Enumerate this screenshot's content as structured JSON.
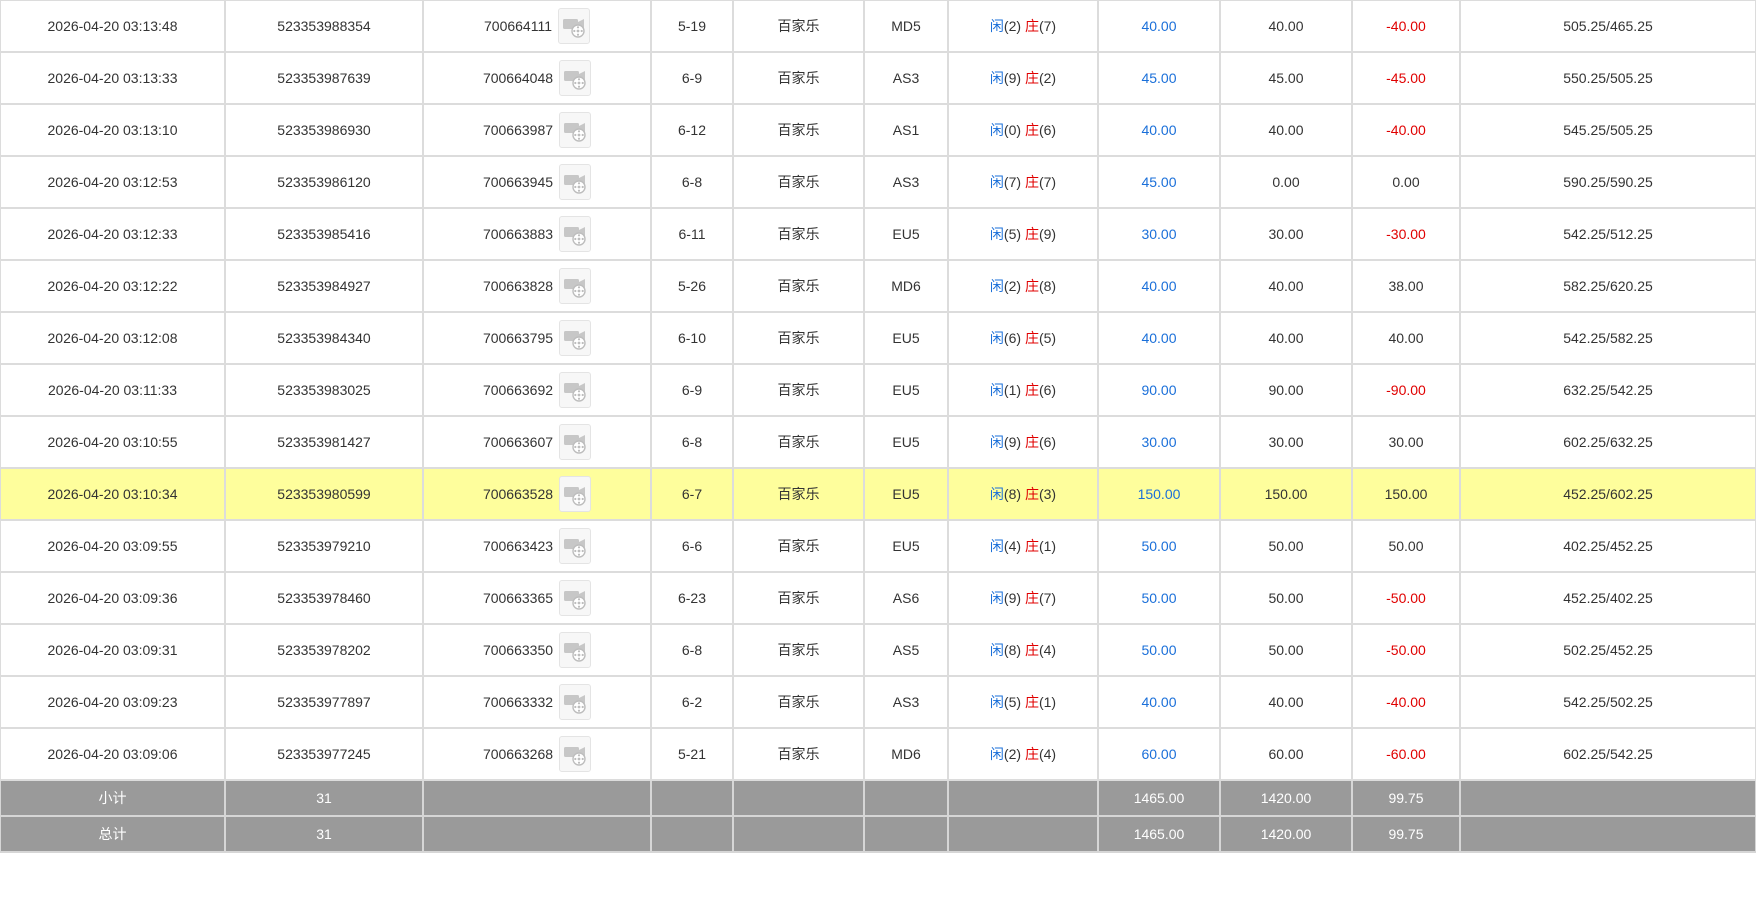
{
  "rows": [
    {
      "time": "2026-04-20 03:13:48",
      "order_no": "523353988354",
      "round_no": "700664111",
      "shoe": "5-19",
      "game": "百家乐",
      "table": "MD5",
      "player_label": "闲",
      "player_score": "(2)",
      "banker_label": "庄",
      "banker_score": "(7)",
      "bet": "40.00",
      "valid_bet": "40.00",
      "win_loss": "-40.00",
      "win_loss_color": "red",
      "balance": "505.25/465.25",
      "highlight": false
    },
    {
      "time": "2026-04-20 03:13:33",
      "order_no": "523353987639",
      "round_no": "700664048",
      "shoe": "6-9",
      "game": "百家乐",
      "table": "AS3",
      "player_label": "闲",
      "player_score": "(9)",
      "banker_label": "庄",
      "banker_score": "(2)",
      "bet": "45.00",
      "valid_bet": "45.00",
      "win_loss": "-45.00",
      "win_loss_color": "red",
      "balance": "550.25/505.25",
      "highlight": false
    },
    {
      "time": "2026-04-20 03:13:10",
      "order_no": "523353986930",
      "round_no": "700663987",
      "shoe": "6-12",
      "game": "百家乐",
      "table": "AS1",
      "player_label": "闲",
      "player_score": "(0)",
      "banker_label": "庄",
      "banker_score": "(6)",
      "bet": "40.00",
      "valid_bet": "40.00",
      "win_loss": "-40.00",
      "win_loss_color": "red",
      "balance": "545.25/505.25",
      "highlight": false
    },
    {
      "time": "2026-04-20 03:12:53",
      "order_no": "523353986120",
      "round_no": "700663945",
      "shoe": "6-8",
      "game": "百家乐",
      "table": "AS3",
      "player_label": "闲",
      "player_score": "(7)",
      "banker_label": "庄",
      "banker_score": "(7)",
      "bet": "45.00",
      "valid_bet": "0.00",
      "win_loss": "0.00",
      "win_loss_color": "default",
      "balance": "590.25/590.25",
      "highlight": false
    },
    {
      "time": "2026-04-20 03:12:33",
      "order_no": "523353985416",
      "round_no": "700663883",
      "shoe": "6-11",
      "game": "百家乐",
      "table": "EU5",
      "player_label": "闲",
      "player_score": "(5)",
      "banker_label": "庄",
      "banker_score": "(9)",
      "bet": "30.00",
      "valid_bet": "30.00",
      "win_loss": "-30.00",
      "win_loss_color": "red",
      "balance": "542.25/512.25",
      "highlight": false
    },
    {
      "time": "2026-04-20 03:12:22",
      "order_no": "523353984927",
      "round_no": "700663828",
      "shoe": "5-26",
      "game": "百家乐",
      "table": "MD6",
      "player_label": "闲",
      "player_score": "(2)",
      "banker_label": "庄",
      "banker_score": "(8)",
      "bet": "40.00",
      "valid_bet": "40.00",
      "win_loss": "38.00",
      "win_loss_color": "default",
      "balance": "582.25/620.25",
      "highlight": false
    },
    {
      "time": "2026-04-20 03:12:08",
      "order_no": "523353984340",
      "round_no": "700663795",
      "shoe": "6-10",
      "game": "百家乐",
      "table": "EU5",
      "player_label": "闲",
      "player_score": "(6)",
      "banker_label": "庄",
      "banker_score": "(5)",
      "bet": "40.00",
      "valid_bet": "40.00",
      "win_loss": "40.00",
      "win_loss_color": "default",
      "balance": "542.25/582.25",
      "highlight": false
    },
    {
      "time": "2026-04-20 03:11:33",
      "order_no": "523353983025",
      "round_no": "700663692",
      "shoe": "6-9",
      "game": "百家乐",
      "table": "EU5",
      "player_label": "闲",
      "player_score": "(1)",
      "banker_label": "庄",
      "banker_score": "(6)",
      "bet": "90.00",
      "valid_bet": "90.00",
      "win_loss": "-90.00",
      "win_loss_color": "red",
      "balance": "632.25/542.25",
      "highlight": false
    },
    {
      "time": "2026-04-20 03:10:55",
      "order_no": "523353981427",
      "round_no": "700663607",
      "shoe": "6-8",
      "game": "百家乐",
      "table": "EU5",
      "player_label": "闲",
      "player_score": "(9)",
      "banker_label": "庄",
      "banker_score": "(6)",
      "bet": "30.00",
      "valid_bet": "30.00",
      "win_loss": "30.00",
      "win_loss_color": "default",
      "balance": "602.25/632.25",
      "highlight": false
    },
    {
      "time": "2026-04-20 03:10:34",
      "order_no": "523353980599",
      "round_no": "700663528",
      "shoe": "6-7",
      "game": "百家乐",
      "table": "EU5",
      "player_label": "闲",
      "player_score": "(8)",
      "banker_label": "庄",
      "banker_score": "(3)",
      "bet": "150.00",
      "valid_bet": "150.00",
      "win_loss": "150.00",
      "win_loss_color": "default",
      "balance": "452.25/602.25",
      "highlight": true
    },
    {
      "time": "2026-04-20 03:09:55",
      "order_no": "523353979210",
      "round_no": "700663423",
      "shoe": "6-6",
      "game": "百家乐",
      "table": "EU5",
      "player_label": "闲",
      "player_score": "(4)",
      "banker_label": "庄",
      "banker_score": "(1)",
      "bet": "50.00",
      "valid_bet": "50.00",
      "win_loss": "50.00",
      "win_loss_color": "default",
      "balance": "402.25/452.25",
      "highlight": false
    },
    {
      "time": "2026-04-20 03:09:36",
      "order_no": "523353978460",
      "round_no": "700663365",
      "shoe": "6-23",
      "game": "百家乐",
      "table": "AS6",
      "player_label": "闲",
      "player_score": "(9)",
      "banker_label": "庄",
      "banker_score": "(7)",
      "bet": "50.00",
      "valid_bet": "50.00",
      "win_loss": "-50.00",
      "win_loss_color": "red",
      "balance": "452.25/402.25",
      "highlight": false
    },
    {
      "time": "2026-04-20 03:09:31",
      "order_no": "523353978202",
      "round_no": "700663350",
      "shoe": "6-8",
      "game": "百家乐",
      "table": "AS5",
      "player_label": "闲",
      "player_score": "(8)",
      "banker_label": "庄",
      "banker_score": "(4)",
      "bet": "50.00",
      "valid_bet": "50.00",
      "win_loss": "-50.00",
      "win_loss_color": "red",
      "balance": "502.25/452.25",
      "highlight": false
    },
    {
      "time": "2026-04-20 03:09:23",
      "order_no": "523353977897",
      "round_no": "700663332",
      "shoe": "6-2",
      "game": "百家乐",
      "table": "AS3",
      "player_label": "闲",
      "player_score": "(5)",
      "banker_label": "庄",
      "banker_score": "(1)",
      "bet": "40.00",
      "valid_bet": "40.00",
      "win_loss": "-40.00",
      "win_loss_color": "red",
      "balance": "542.25/502.25",
      "highlight": false
    },
    {
      "time": "2026-04-20 03:09:06",
      "order_no": "523353977245",
      "round_no": "700663268",
      "shoe": "5-21",
      "game": "百家乐",
      "table": "MD6",
      "player_label": "闲",
      "player_score": "(2)",
      "banker_label": "庄",
      "banker_score": "(4)",
      "bet": "60.00",
      "valid_bet": "60.00",
      "win_loss": "-60.00",
      "win_loss_color": "red",
      "balance": "602.25/542.25",
      "highlight": false
    }
  ],
  "subtotal": {
    "label": "小计",
    "count": "31",
    "bet": "1465.00",
    "valid_bet": "1420.00",
    "win_loss": "99.75"
  },
  "total": {
    "label": "总计",
    "count": "31",
    "bet": "1465.00",
    "valid_bet": "1420.00",
    "win_loss": "99.75"
  },
  "icons": {
    "video": "video-replay-icon"
  },
  "colors": {
    "highlight_row": "#fefe9c",
    "summary_row": "#9a9a9a",
    "blue": "#1a6fd9",
    "red": "#e00000"
  }
}
